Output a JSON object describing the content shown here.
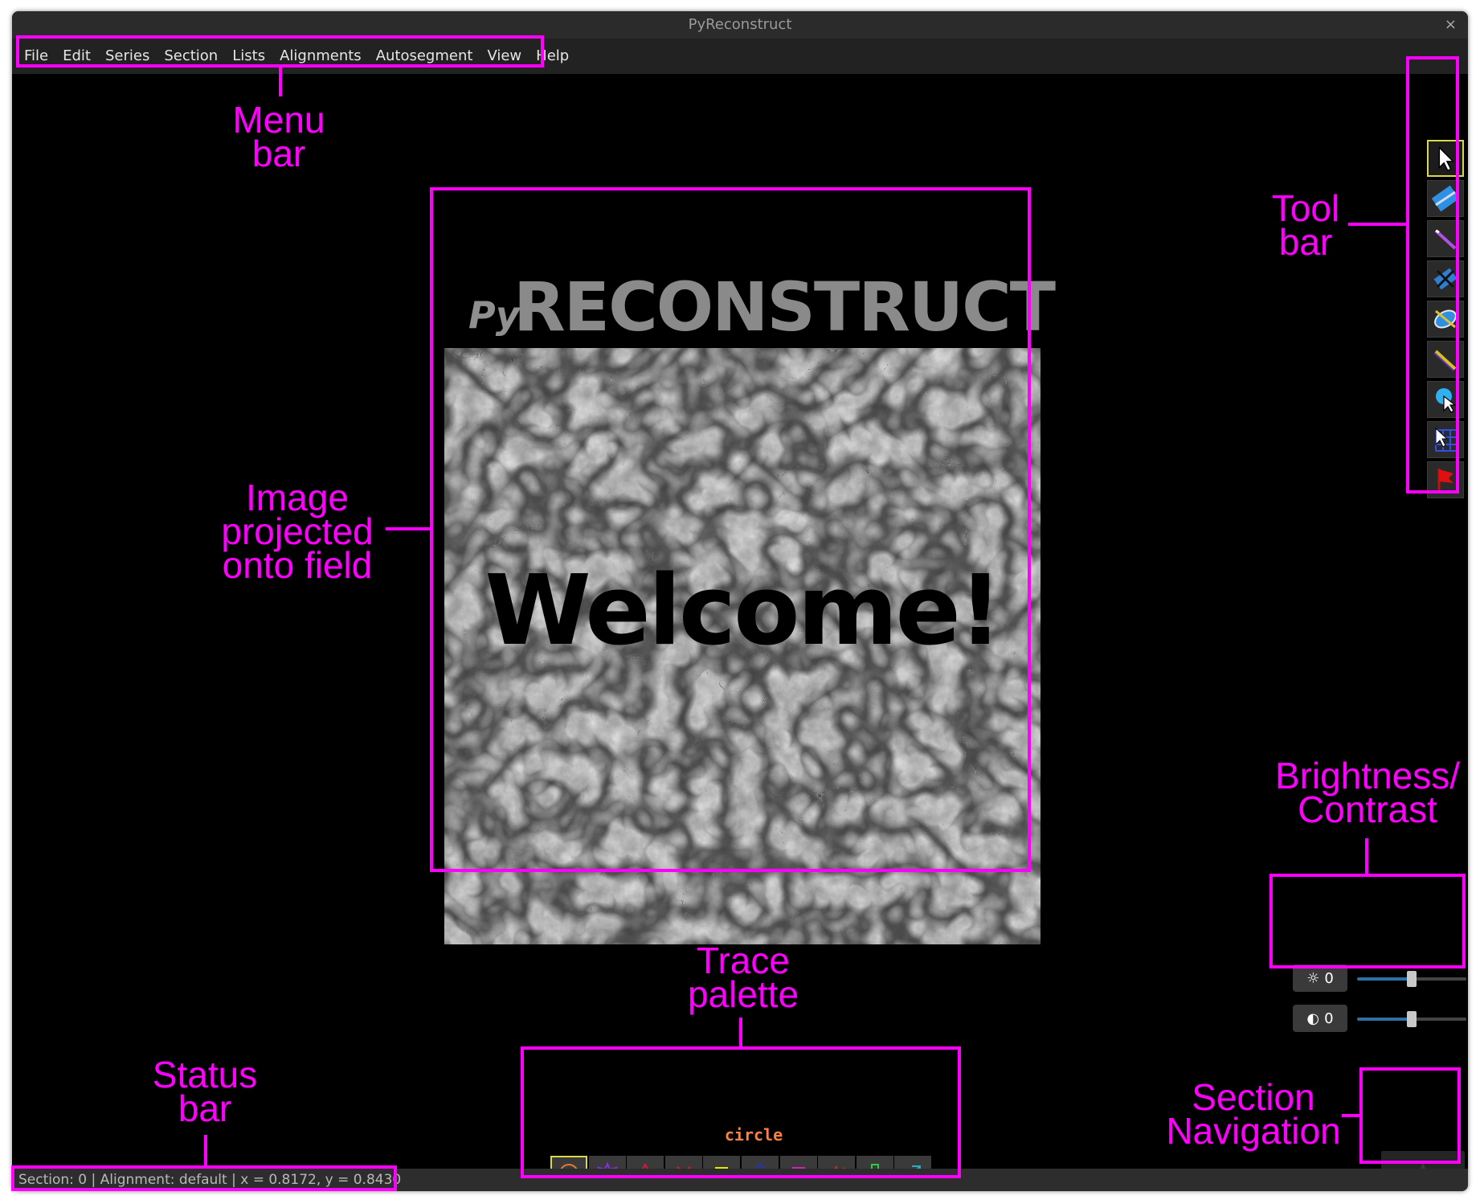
{
  "window": {
    "title": "PyReconstruct",
    "close": "×"
  },
  "menu": [
    "File",
    "Edit",
    "Series",
    "Section",
    "Lists",
    "Alignments",
    "Autosegment",
    "View",
    "Help"
  ],
  "image": {
    "logo_prefix": "Py",
    "logo_main": "RECONSTRUCT",
    "welcome": "Welcome!"
  },
  "toolbar": {
    "tools": [
      {
        "icon": "pointer-icon",
        "selected": true
      },
      {
        "icon": "pan-zoom-icon"
      },
      {
        "icon": "knife-icon"
      },
      {
        "icon": "scissors-icon"
      },
      {
        "icon": "closed-trace-icon"
      },
      {
        "icon": "open-trace-icon"
      },
      {
        "icon": "stamp-icon"
      },
      {
        "icon": "grid-icon"
      },
      {
        "icon": "flag-icon"
      }
    ]
  },
  "brightness_contrast": {
    "brightness_value": "0",
    "contrast_value": "0",
    "brightness_level": 0.5,
    "contrast_level": 0.5
  },
  "palette": {
    "selected_name": "circle",
    "row1": [
      {
        "shape": "circle",
        "color": "#e07b39",
        "selected": true
      },
      {
        "shape": "star",
        "color": "#8a2be2"
      },
      {
        "shape": "triangle",
        "color": "#dc143c"
      },
      {
        "shape": "x",
        "color": "#d11a1a"
      },
      {
        "shape": "square",
        "color": "#e6e600"
      },
      {
        "shape": "diamond",
        "color": "#2233bb"
      },
      {
        "shape": "square",
        "color": "#d020c0"
      },
      {
        "shape": "arrow-left",
        "color": "#cc2a1a"
      },
      {
        "shape": "cross",
        "color": "#2ecc40"
      },
      {
        "shape": "arrow-ne",
        "color": "#20b0c0"
      }
    ],
    "row2": [
      {
        "shape": "circle",
        "color": "#e07b39"
      },
      {
        "shape": "star",
        "color": "#8a2be2"
      },
      {
        "shape": "triangle",
        "color": "#dc143c"
      },
      {
        "shape": "x",
        "color": "#d11a1a"
      },
      {
        "shape": "square",
        "color": "#e6e600"
      },
      {
        "shape": "diamond",
        "color": "#2233bb"
      },
      {
        "shape": "square",
        "color": "#d020c0"
      },
      {
        "shape": "arrow-left",
        "color": "#cc2a1a"
      },
      {
        "shape": "cross",
        "color": "#2ecc40"
      },
      {
        "shape": "arrow-ne",
        "color": "#20b0c0"
      }
    ],
    "plus": "+",
    "minus": "-",
    "menu": "≡"
  },
  "section_nav": {
    "up": "▲",
    "down": "▼"
  },
  "status": {
    "text": "Section: 0  |  Alignment: default  |  x = 0.8172, y = 0.8430"
  },
  "annotations": {
    "menu_bar": "Menu\nbar",
    "tool_bar": "Tool\nbar",
    "image": "Image\nprojected\nonto field",
    "brightness": "Brightness/\nContrast",
    "trace_palette": "Trace\npalette",
    "status_bar": "Status\nbar",
    "section_nav": "Section\nNavigation"
  },
  "colors": {
    "highlight": "#ff00ff",
    "background": "#000000"
  }
}
